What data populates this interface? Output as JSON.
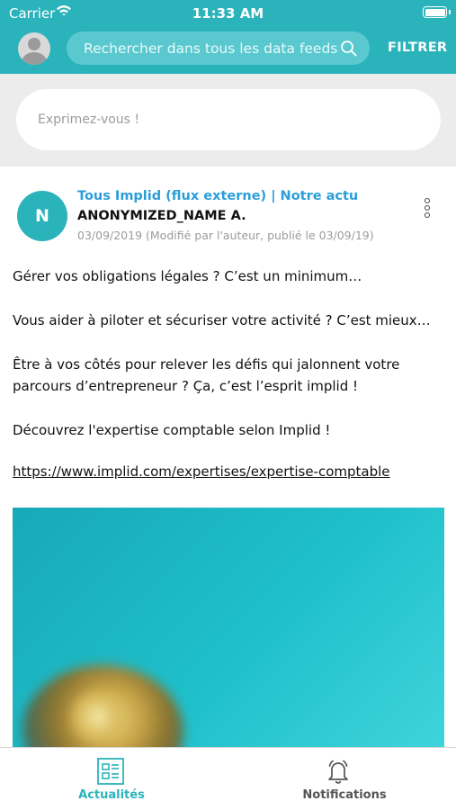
{
  "status_bar": {
    "carrier": "Carrier",
    "time": "11:33 AM"
  },
  "header": {
    "search_placeholder": "Rechercher dans tous les data feeds",
    "filter_label": "FILTRER"
  },
  "compose": {
    "placeholder": "Exprimez-vous !"
  },
  "post": {
    "avatar_letter": "N",
    "source": "Tous Implid (flux externe) | Notre actu",
    "author": "ANONYMIZED_NAME A.",
    "date": "03/09/2019 (Modifié par l'auteur, publié le 03/09/19)",
    "paragraphs": [
      "Gérer vos obligations légales ? C’est un minimum…",
      "Vous aider à piloter et sécuriser votre activité ? C’est mieux…",
      "Être à vos côtés pour relever les défis qui jalonnent votre parcours d’entrepreneur ? Ça, c’est l’esprit implid !",
      "Découvrez l'expertise comptable selon Implid !"
    ],
    "link": "https://www.implid.com/expertises/expertise-comptable"
  },
  "tabs": [
    {
      "label": "Actualités",
      "icon": "newspaper-icon",
      "active": true
    },
    {
      "label": "Notifications",
      "icon": "bell-alarm-icon",
      "active": false
    }
  ],
  "colors": {
    "brand_teal": "#2bb3bb",
    "link_blue": "#2b9ed8",
    "compose_bg": "#ececec"
  }
}
